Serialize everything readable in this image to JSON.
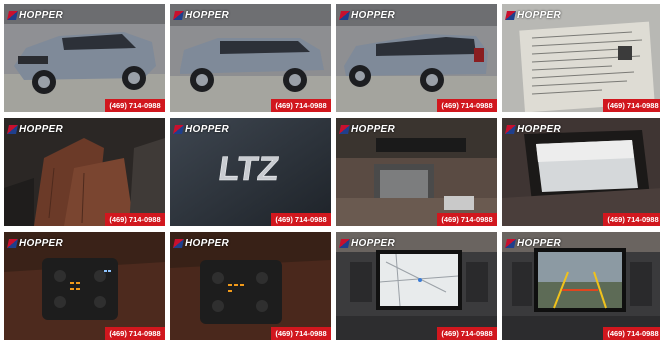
{
  "brand": "HOPPER",
  "phone": "(469) 714-0988",
  "photos": [
    {
      "name": "photo-front-left-exterior"
    },
    {
      "name": "photo-side-exterior"
    },
    {
      "name": "photo-rear-left-exterior"
    },
    {
      "name": "photo-window-sticker"
    },
    {
      "name": "photo-front-seats"
    },
    {
      "name": "photo-ltz-badge"
    },
    {
      "name": "photo-rear-entertainment-screen"
    },
    {
      "name": "photo-sunroof"
    },
    {
      "name": "photo-seat-controls-1"
    },
    {
      "name": "photo-seat-controls-2"
    },
    {
      "name": "photo-navigation-screen"
    },
    {
      "name": "photo-backup-camera-screen"
    }
  ],
  "badge_text": "LTZ",
  "colors": {
    "phone_bg": "#d1171e",
    "car_body": "#7f8a99",
    "leather": "#6b3a28"
  }
}
